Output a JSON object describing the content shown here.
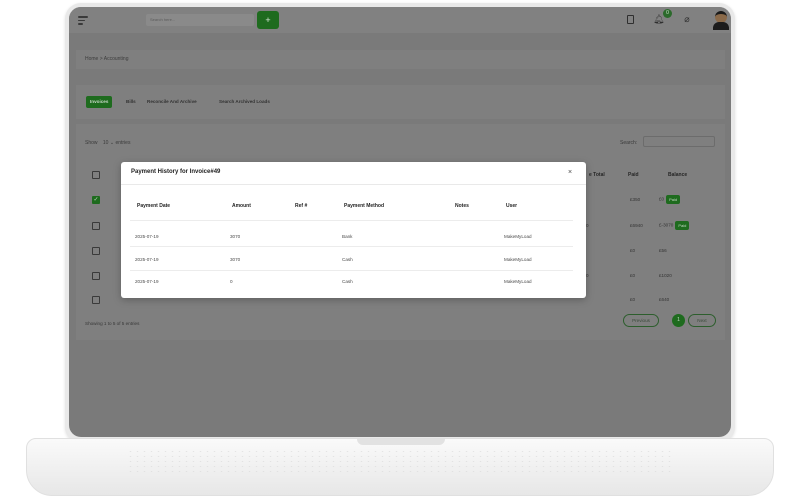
{
  "header": {
    "search_placeholder": "Search here...",
    "add_label": "+",
    "notification_count": "0",
    "icons": [
      "menu-icon",
      "document-icon",
      "bell-icon",
      "eye-off-icon",
      "avatar"
    ]
  },
  "breadcrumb": "Home > Accounting",
  "tabs": [
    {
      "label": "Invoices",
      "active": true
    },
    {
      "label": "Bills",
      "active": false
    },
    {
      "label": "Reconcile And Archive",
      "active": false
    },
    {
      "label": "Search Archived Loads",
      "active": false
    }
  ],
  "table_controls": {
    "show_label": "Show",
    "entries_value": "10",
    "entries_label": "entries",
    "search_label": "Search:"
  },
  "background_table": {
    "visible_headers": [
      "e Total",
      "Paid",
      "Balance"
    ],
    "rows": [
      {
        "checked": true,
        "paid": "£350",
        "balance": "£0",
        "status": "Paid"
      },
      {
        "checked": false,
        "total_fragment": "0",
        "paid": "£6940",
        "balance": "£-3070",
        "status": "Paid"
      },
      {
        "checked": false,
        "paid": "£0",
        "balance": "£56"
      },
      {
        "checked": false,
        "total_fragment": "0",
        "paid": "£0",
        "balance": "£1020"
      },
      {
        "checked": false,
        "paid": "£0",
        "balance": "£640"
      }
    ],
    "showing_text": "Showing 1 to 5 of 5 entries",
    "pagination": {
      "previous": "Previous",
      "current": "1",
      "next": "Next"
    }
  },
  "modal": {
    "title": "Payment History for Invoice#49",
    "close_label": "×",
    "columns": [
      "Payment Date",
      "Amount",
      "Ref #",
      "Payment Method",
      "Notes",
      "User"
    ],
    "rows": [
      {
        "date": "2025-07-19",
        "amount": "3070",
        "ref": "",
        "method": "Bank",
        "notes": "",
        "user": "MakeMyLoad"
      },
      {
        "date": "2025-07-19",
        "amount": "3070",
        "ref": "",
        "method": "Cash",
        "notes": "",
        "user": "MakeMyLoad"
      },
      {
        "date": "2025-07-19",
        "amount": "0",
        "ref": "",
        "method": "Cash",
        "notes": "",
        "user": "MakeMyLoad"
      }
    ]
  },
  "colors": {
    "accent_green": "#2e9c2e",
    "overlay_dim": "#7a7a7a"
  }
}
